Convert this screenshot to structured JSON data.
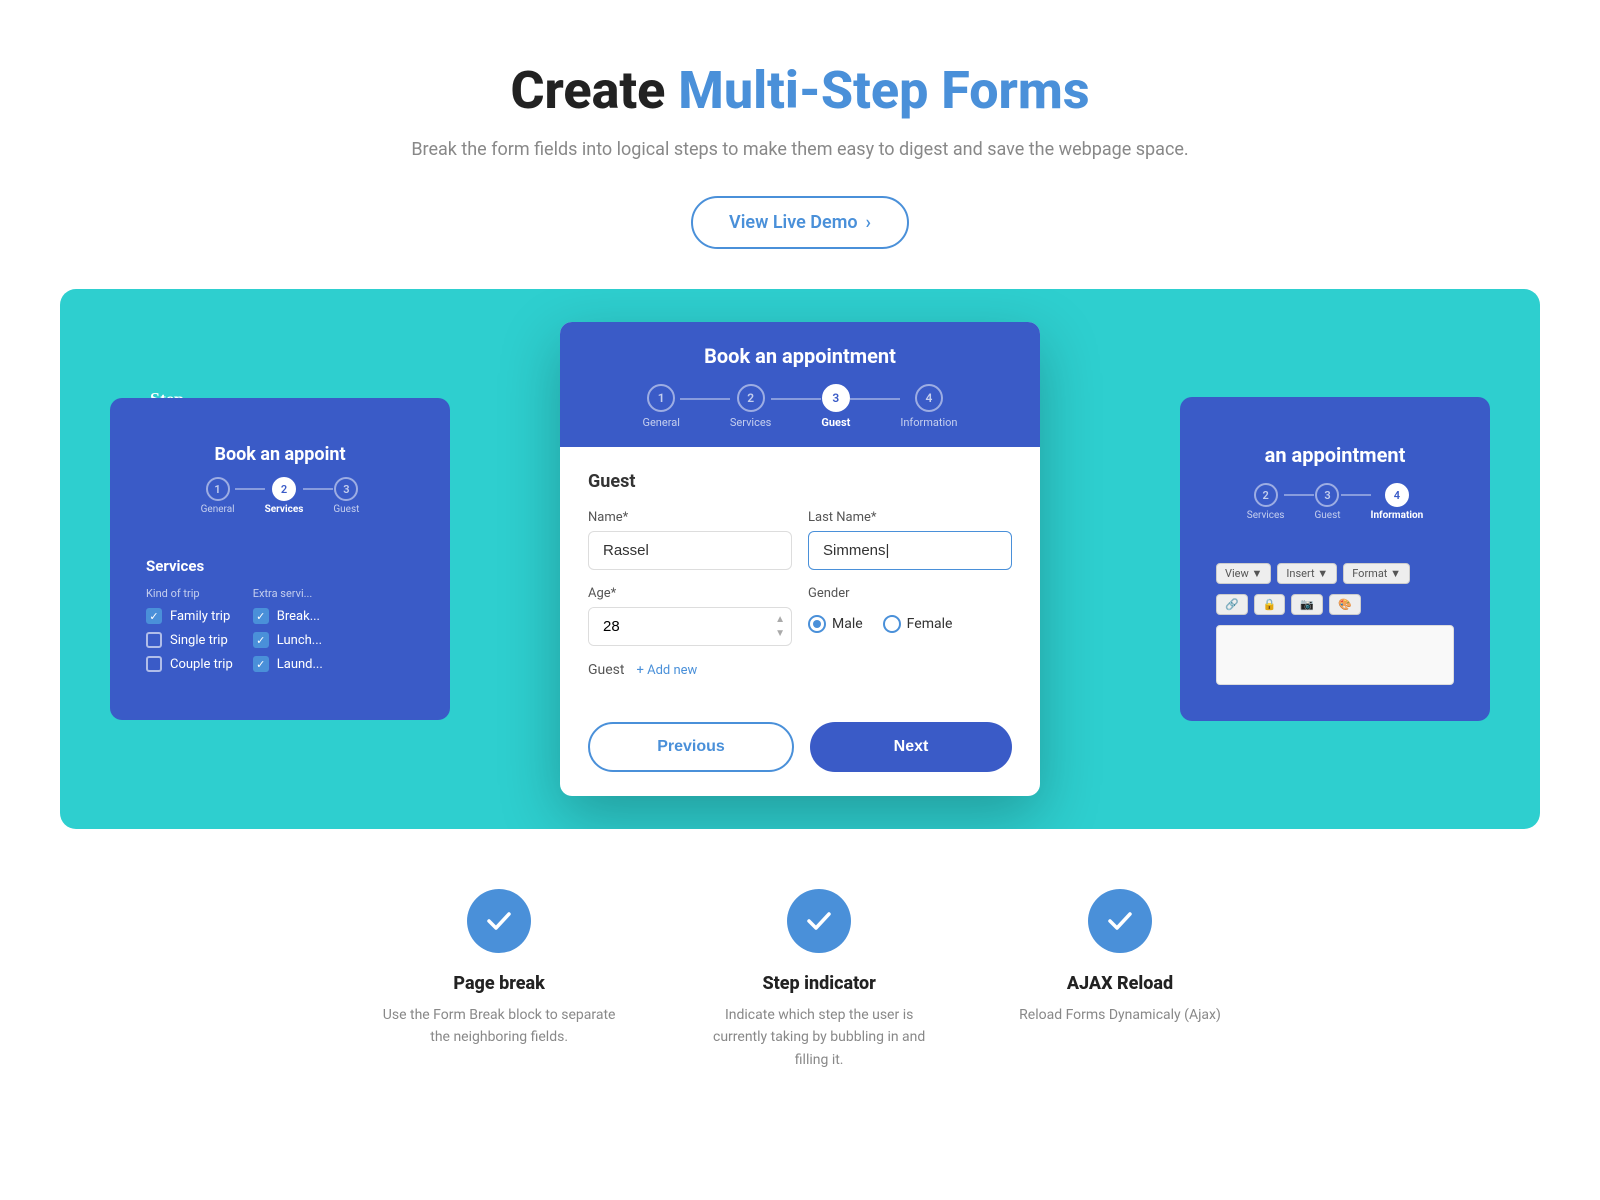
{
  "header": {
    "title_normal": "Create ",
    "title_accent": "Multi-Step Forms",
    "subtitle": "Break the form fields into logical steps to make them easy to digest and save the webpage space.",
    "demo_button": "View Live Demo",
    "demo_button_arrow": "›"
  },
  "left_card": {
    "title": "Book an appoint",
    "step_indicator_label": "Step\nindicator",
    "steps": [
      {
        "number": "1",
        "label": "General",
        "active": false
      },
      {
        "number": "2",
        "label": "Services",
        "active": true
      },
      {
        "number": "3",
        "label": "Guest",
        "active": false
      }
    ],
    "services_title": "Services",
    "kind_of_trip_label": "Kind of trip",
    "extra_services_label": "Extra servi...",
    "trips": [
      {
        "label": "Family trip",
        "checked": true
      },
      {
        "label": "Single trip",
        "checked": false
      },
      {
        "label": "Couple trip",
        "checked": false
      }
    ],
    "extras": [
      {
        "label": "Break...",
        "checked": true
      },
      {
        "label": "Lunch...",
        "checked": true
      },
      {
        "label": "Laund...",
        "checked": true
      }
    ]
  },
  "center_card": {
    "title": "Book an appointment",
    "steps": [
      {
        "number": "1",
        "label": "General",
        "active": false
      },
      {
        "number": "2",
        "label": "Services",
        "active": false
      },
      {
        "number": "3",
        "label": "Guest",
        "active": true
      },
      {
        "number": "4",
        "label": "Information",
        "active": false
      }
    ],
    "section_title": "Guest",
    "name_label": "Name*",
    "name_value": "Rassel",
    "lastname_label": "Last Name*",
    "lastname_value": "Simmens|",
    "age_label": "Age*",
    "age_value": "28",
    "gender_label": "Gender",
    "gender_options": [
      "Male",
      "Female"
    ],
    "gender_selected": "Male",
    "guest_label": "Guest",
    "add_new_label": "+ Add new",
    "prev_button": "Previous",
    "next_button": "Next"
  },
  "right_card": {
    "title": "an appointment",
    "steps": [
      {
        "number": "2",
        "label": "Services",
        "active": false
      },
      {
        "number": "3",
        "label": "Guest",
        "active": false
      },
      {
        "number": "4",
        "label": "Information",
        "active": true
      }
    ],
    "toolbar_items": [
      "View ▼",
      "Insert ▼",
      "Format ▼"
    ],
    "toolbar_icons": [
      "🔗",
      "🔒",
      "📷",
      "🎨"
    ]
  },
  "features": [
    {
      "id": "page-break",
      "title": "Page break",
      "description": "Use the Form Break block to separate the neighboring fields."
    },
    {
      "id": "step-indicator",
      "title": "Step indicator",
      "description": "Indicate which step the user is currently taking by bubbling in and filling it."
    },
    {
      "id": "ajax-reload",
      "title": "AJAX Reload",
      "description": "Reload Forms Dynamicaly (Ajax)"
    }
  ]
}
